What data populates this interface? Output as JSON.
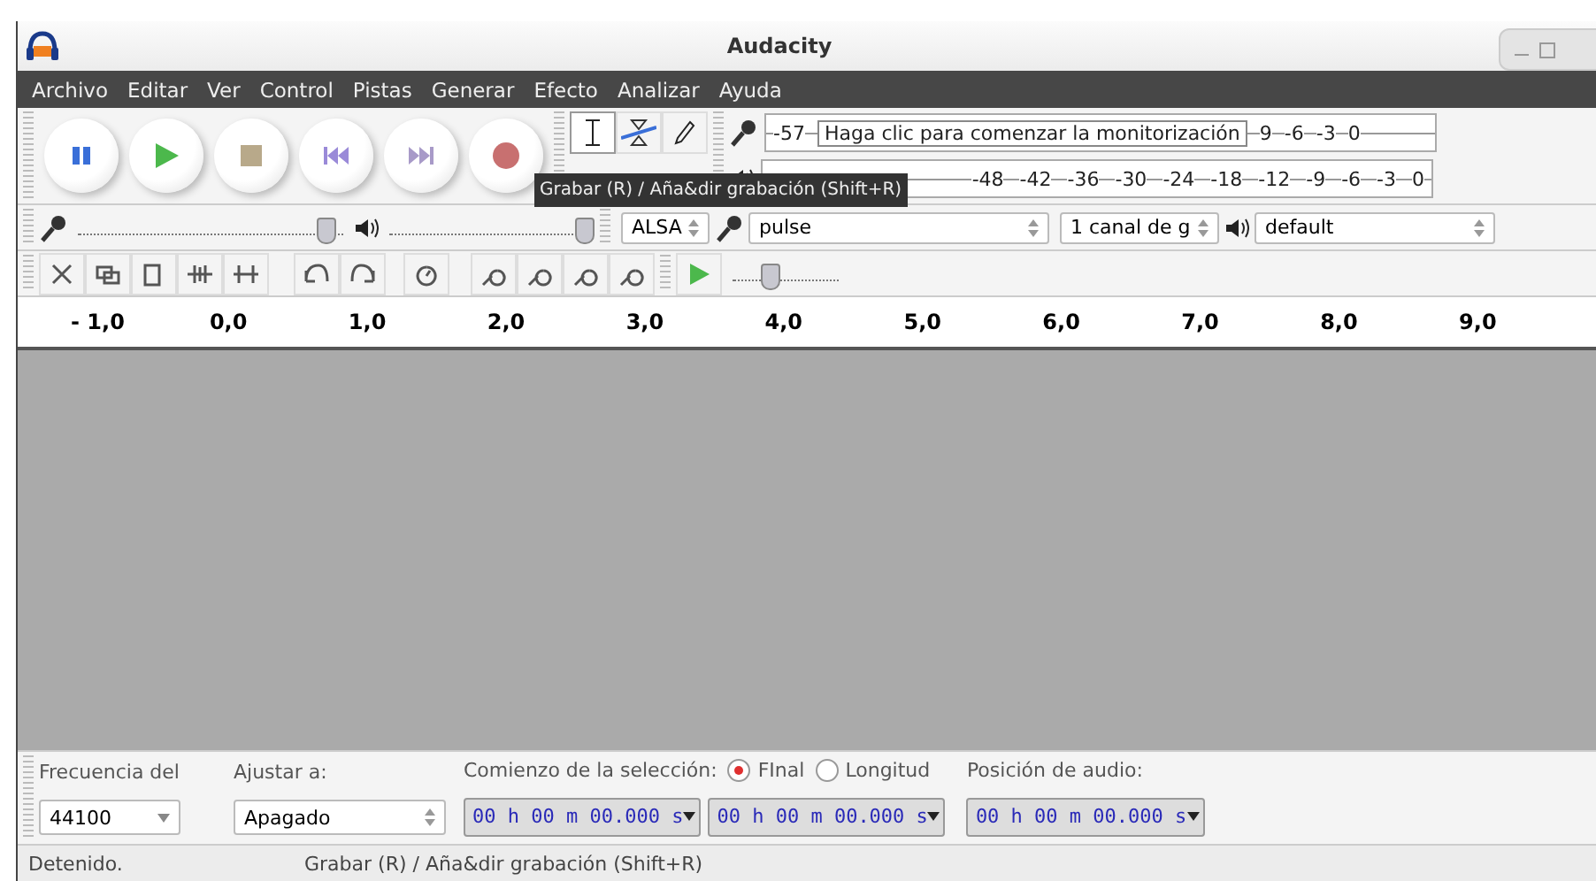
{
  "window": {
    "title": "Audacity"
  },
  "menu": [
    {
      "label": "Archivo"
    },
    {
      "label": "Editar"
    },
    {
      "label": "Ver"
    },
    {
      "label": "Control"
    },
    {
      "label": "Pistas"
    },
    {
      "label": "Generar"
    },
    {
      "label": "Efecto"
    },
    {
      "label": "Analizar"
    },
    {
      "label": "Ayuda"
    }
  ],
  "transport": [
    {
      "kind": "pause"
    },
    {
      "kind": "play"
    },
    {
      "kind": "stop"
    },
    {
      "kind": "skip-start"
    },
    {
      "kind": "skip-end"
    },
    {
      "kind": "record"
    }
  ],
  "tools": [
    {
      "kind": "select",
      "selected": true
    },
    {
      "kind": "envelope",
      "selected": false
    },
    {
      "kind": "draw",
      "selected": false
    }
  ],
  "record_meter": {
    "scale_start": "-57",
    "hint": "Haga clic para comenzar la monitorización",
    "scale_end": [
      "9",
      "-6",
      "-3",
      "0"
    ]
  },
  "play_meter": {
    "scale": [
      "-48",
      "-42",
      "-36",
      "-30",
      "-24",
      "-18",
      "-12",
      "-9",
      "-6",
      "-3",
      "0"
    ]
  },
  "mixer": {
    "record": {
      "level": 0.93
    },
    "play": {
      "level": 1.0
    }
  },
  "devices": {
    "host": "ALSA",
    "input": "pulse",
    "channels": "1 canal de g",
    "output": "default"
  },
  "play_at_speed": {
    "level": 0.35
  },
  "tooltip": "Grabar (R) / Aña&dir grabación (Shift+R)",
  "ruler": [
    "- 1,0",
    "0,0",
    "1,0",
    "2,0",
    "3,0",
    "4,0",
    "5,0",
    "6,0",
    "7,0",
    "8,0",
    "9,0"
  ],
  "selection_bar": {
    "rate_label": "Frecuencia del",
    "rate": "44100",
    "snap_label": "Ajustar a:",
    "snap": "Apagado",
    "start_label": "Comienzo de la selección:",
    "end_modes": [
      {
        "label": "FInal",
        "selected": true
      },
      {
        "label": "Longitud",
        "selected": false
      }
    ],
    "start": "00 h 00 m 00.000 s",
    "end": "00 h 00 m 00.000 s",
    "position_label": "Posición de audio:",
    "position": "00 h 00 m 00.000 s"
  },
  "status_bar": {
    "state": "Detenido.",
    "message": "Grabar (R) / Aña&dir grabación (Shift+R)"
  }
}
